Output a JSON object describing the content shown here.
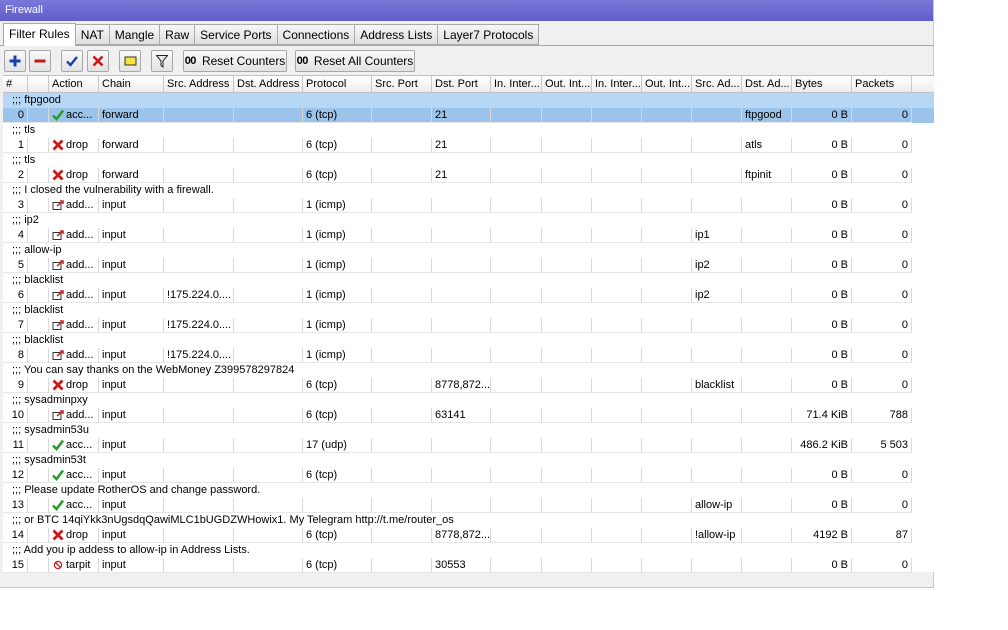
{
  "window": {
    "title": "Firewall"
  },
  "tabs": [
    "Filter Rules",
    "NAT",
    "Mangle",
    "Raw",
    "Service Ports",
    "Connections",
    "Address Lists",
    "Layer7 Protocols"
  ],
  "toolbar": {
    "reset_counters": "Reset Counters",
    "reset_all_counters": "Reset All Counters",
    "counter_glyph": "00"
  },
  "columns": [
    "#",
    "",
    "Action",
    "Chain",
    "Src. Address",
    "Dst. Address",
    "Protocol",
    "Src. Port",
    "Dst. Port",
    "In. Inter...",
    "Out. Int...",
    "In. Inter...",
    "Out. Int...",
    "Src. Ad...",
    "Dst. Ad...",
    "Bytes",
    "Packets"
  ],
  "comments": [
    ";;; ftpgood",
    ";;; tls",
    ";;; tls",
    ";;; I closed the vulnerability with a firewall.",
    ";;; ip2",
    ";;; allow-ip",
    ";;; blacklist",
    ";;; blacklist",
    ";;; blacklist",
    ";;; You can say thanks on the WebMoney Z399578297824",
    ";;; sysadminpxy",
    ";;; sysadmin53u",
    ";;; sysadmin53t",
    ";;; Please update RotherOS and change password.",
    ";;; or BTC 14qiYkk3nUgsdqQawiMLC1bUGDZWHowix1. My Telegram http://t.me/router_os",
    ";;; Add you ip addess to allow-ip in Address Lists."
  ],
  "rules": [
    {
      "num": "0",
      "icon": "accept",
      "action": "acc...",
      "chain": "forward",
      "src": "",
      "proto": "6 (tcp)",
      "dport": "21",
      "srcal": "",
      "dstal": "ftpgood",
      "bytes": "0 B",
      "packets": "0"
    },
    {
      "num": "1",
      "icon": "drop",
      "action": "drop",
      "chain": "forward",
      "src": "",
      "proto": "6 (tcp)",
      "dport": "21",
      "srcal": "",
      "dstal": "atls",
      "bytes": "0 B",
      "packets": "0"
    },
    {
      "num": "2",
      "icon": "drop",
      "action": "drop",
      "chain": "forward",
      "src": "",
      "proto": "6 (tcp)",
      "dport": "21",
      "srcal": "",
      "dstal": "ftpinit",
      "bytes": "0 B",
      "packets": "0"
    },
    {
      "num": "3",
      "icon": "add",
      "action": "add...",
      "chain": "input",
      "src": "",
      "proto": "1 (icmp)",
      "dport": "",
      "srcal": "",
      "dstal": "",
      "bytes": "0 B",
      "packets": "0"
    },
    {
      "num": "4",
      "icon": "add",
      "action": "add...",
      "chain": "input",
      "src": "",
      "proto": "1 (icmp)",
      "dport": "",
      "srcal": "ip1",
      "dstal": "",
      "bytes": "0 B",
      "packets": "0"
    },
    {
      "num": "5",
      "icon": "add",
      "action": "add...",
      "chain": "input",
      "src": "",
      "proto": "1 (icmp)",
      "dport": "",
      "srcal": "ip2",
      "dstal": "",
      "bytes": "0 B",
      "packets": "0"
    },
    {
      "num": "6",
      "icon": "add",
      "action": "add...",
      "chain": "input",
      "src": "!175.224.0....",
      "proto": "1 (icmp)",
      "dport": "",
      "srcal": "ip2",
      "dstal": "",
      "bytes": "0 B",
      "packets": "0"
    },
    {
      "num": "7",
      "icon": "add",
      "action": "add...",
      "chain": "input",
      "src": "!175.224.0....",
      "proto": "1 (icmp)",
      "dport": "",
      "srcal": "",
      "dstal": "",
      "bytes": "0 B",
      "packets": "0"
    },
    {
      "num": "8",
      "icon": "add",
      "action": "add...",
      "chain": "input",
      "src": "!175.224.0....",
      "proto": "1 (icmp)",
      "dport": "",
      "srcal": "",
      "dstal": "",
      "bytes": "0 B",
      "packets": "0"
    },
    {
      "num": "9",
      "icon": "drop",
      "action": "drop",
      "chain": "input",
      "src": "",
      "proto": "6 (tcp)",
      "dport": "8778,872...",
      "srcal": "blacklist",
      "dstal": "",
      "bytes": "0 B",
      "packets": "0"
    },
    {
      "num": "10",
      "icon": "add",
      "action": "add...",
      "chain": "input",
      "src": "",
      "proto": "6 (tcp)",
      "dport": "63141",
      "srcal": "",
      "dstal": "",
      "bytes": "71.4 KiB",
      "packets": "788"
    },
    {
      "num": "11",
      "icon": "accept",
      "action": "acc...",
      "chain": "input",
      "src": "",
      "proto": "17 (udp)",
      "dport": "",
      "srcal": "",
      "dstal": "",
      "bytes": "486.2 KiB",
      "packets": "5 503"
    },
    {
      "num": "12",
      "icon": "accept",
      "action": "acc...",
      "chain": "input",
      "src": "",
      "proto": "6 (tcp)",
      "dport": "",
      "srcal": "",
      "dstal": "",
      "bytes": "0 B",
      "packets": "0"
    },
    {
      "num": "13",
      "icon": "accept",
      "action": "acc...",
      "chain": "input",
      "src": "",
      "proto": "",
      "dport": "",
      "srcal": "allow-ip",
      "dstal": "",
      "bytes": "0 B",
      "packets": "0"
    },
    {
      "num": "14",
      "icon": "drop",
      "action": "drop",
      "chain": "input",
      "src": "",
      "proto": "6 (tcp)",
      "dport": "8778,872...",
      "srcal": "!allow-ip",
      "dstal": "",
      "bytes": "4192 B",
      "packets": "87"
    },
    {
      "num": "15",
      "icon": "tarpit",
      "action": "tarpit",
      "chain": "input",
      "src": "",
      "proto": "6 (tcp)",
      "dport": "30553",
      "srcal": "",
      "dstal": "",
      "bytes": "0 B",
      "packets": "0"
    }
  ],
  "colors": {
    "accept": "#2e9b2e",
    "drop": "#d01818",
    "add": "#c03030",
    "tarpit": "#c02020",
    "selection": "#b6d8f6",
    "titlebar": "#6a68d0"
  }
}
